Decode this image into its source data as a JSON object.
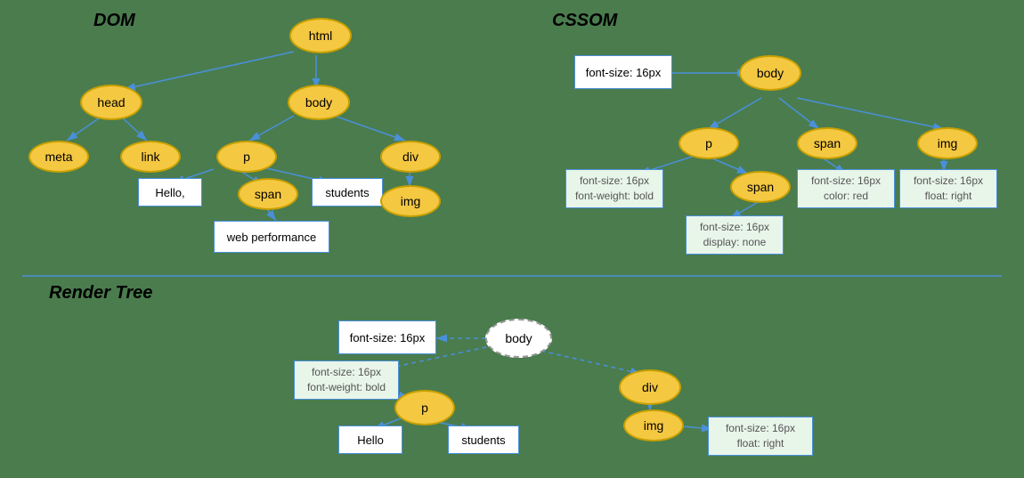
{
  "sections": {
    "dom": {
      "title": "DOM"
    },
    "cssom": {
      "title": "CSSOM"
    },
    "render_tree": {
      "title": "Render Tree"
    }
  },
  "dom_nodes": {
    "html": "html",
    "head": "head",
    "body": "body",
    "meta": "meta",
    "link": "link",
    "p": "p",
    "div": "div",
    "span": "span",
    "img_dom": "img"
  },
  "dom_boxes": {
    "hello": "Hello,",
    "students": "students",
    "web_performance": "web performance"
  },
  "cssom_nodes": {
    "body": "body",
    "p": "p",
    "span_p": "span",
    "span": "span",
    "img": "img"
  },
  "cssom_boxes": {
    "body_style": "font-size: 16px",
    "p_style": "font-size: 16px\nfont-weight: bold",
    "span_p_style": "font-size: 16px\ndisplay: none",
    "span_style": "font-size: 16px\ncolor: red",
    "img_style": "font-size: 16px\nfloat: right"
  },
  "render_nodes": {
    "body": "body",
    "p": "p",
    "div": "div",
    "img": "img"
  },
  "render_boxes": {
    "body_style": "font-size: 16px",
    "p_style": "font-size: 16px\nfont-weight: bold",
    "hello": "Hello",
    "students": "students",
    "img_style": "font-size: 16px\nfloat: right"
  }
}
